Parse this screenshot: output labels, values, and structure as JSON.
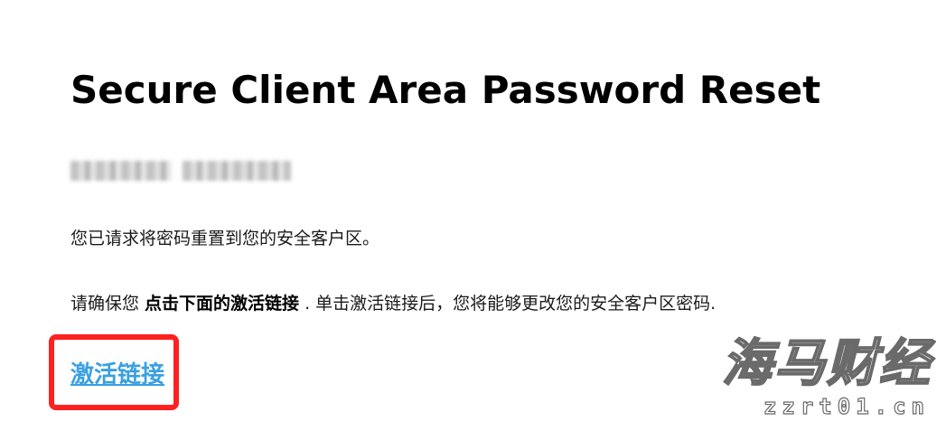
{
  "email": {
    "title": "Secure Client Area Password Reset",
    "paragraph_1": "您已请求将密码重置到您的安全客户区。",
    "paragraph_2": {
      "before": "请确保您 ",
      "bold": "点击下面的激活链接",
      "after": " . 单击激活链接后，您将能够更改您的安全客户区密码."
    },
    "activation_link_label": "激活链接",
    "link_color": "#3aa0e0"
  },
  "annotation": {
    "highlight_color": "#ff2020"
  },
  "watermark": {
    "brand": "海马财经",
    "url": "zzrt01.cn"
  }
}
